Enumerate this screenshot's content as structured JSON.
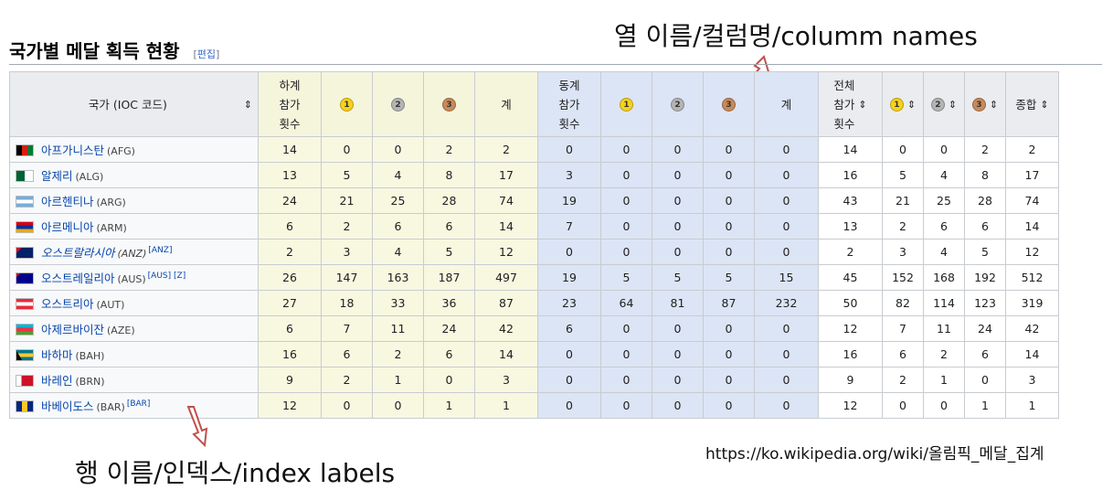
{
  "annotations": {
    "column_names": "열 이름/컬럼명/columm names",
    "index_labels": "행 이름/인덱스/index labels",
    "source_url": "https://ko.wikipedia.org/wiki/올림픽_메달_집계"
  },
  "section": {
    "title": "국가별 메달 획득 현황",
    "edit_open": "[",
    "edit_label": "편집",
    "edit_close": "]"
  },
  "headers": {
    "country": "국가 (IOC 코드)",
    "summer_games": [
      "하계",
      "참가",
      "횟수"
    ],
    "winter_games": [
      "동계",
      "참가",
      "횟수"
    ],
    "total_games": [
      "전체",
      "참가",
      "횟수"
    ],
    "gold": "1",
    "silver": "2",
    "bronze": "3",
    "subtotal": "계",
    "grand_total": "종합"
  },
  "colors": {
    "gold": "#f7d21a",
    "silver": "#b4b4b4",
    "bronze": "#c88a5a",
    "summer_bg": "#f8f8e0",
    "winter_bg": "#dce5f5",
    "link": "#0645ad"
  },
  "rows": [
    {
      "name": "아프가니스탄",
      "ioc": "(AFG)",
      "note": "",
      "italic": false,
      "flag": "afg",
      "summer": [
        "14",
        "0",
        "0",
        "2",
        "2"
      ],
      "winter": [
        "0",
        "0",
        "0",
        "0",
        "0"
      ],
      "total": [
        "14",
        "0",
        "0",
        "2",
        "2"
      ]
    },
    {
      "name": "알제리",
      "ioc": "(ALG)",
      "note": "",
      "italic": false,
      "flag": "alg",
      "summer": [
        "13",
        "5",
        "4",
        "8",
        "17"
      ],
      "winter": [
        "3",
        "0",
        "0",
        "0",
        "0"
      ],
      "total": [
        "16",
        "5",
        "4",
        "8",
        "17"
      ]
    },
    {
      "name": "아르헨티나",
      "ioc": "(ARG)",
      "note": "",
      "italic": false,
      "flag": "arg",
      "summer": [
        "24",
        "21",
        "25",
        "28",
        "74"
      ],
      "winter": [
        "19",
        "0",
        "0",
        "0",
        "0"
      ],
      "total": [
        "43",
        "21",
        "25",
        "28",
        "74"
      ]
    },
    {
      "name": "아르메니아",
      "ioc": "(ARM)",
      "note": "",
      "italic": false,
      "flag": "arm",
      "summer": [
        "6",
        "2",
        "6",
        "6",
        "14"
      ],
      "winter": [
        "7",
        "0",
        "0",
        "0",
        "0"
      ],
      "total": [
        "13",
        "2",
        "6",
        "6",
        "14"
      ]
    },
    {
      "name": "오스트랄라시아",
      "ioc": "(ANZ)",
      "note": "[ANZ]",
      "italic": true,
      "flag": "anz",
      "summer": [
        "2",
        "3",
        "4",
        "5",
        "12"
      ],
      "winter": [
        "0",
        "0",
        "0",
        "0",
        "0"
      ],
      "total": [
        "2",
        "3",
        "4",
        "5",
        "12"
      ]
    },
    {
      "name": "오스트레일리아",
      "ioc": "(AUS)",
      "note": "[AUS] [Z]",
      "italic": false,
      "flag": "aus",
      "summer": [
        "26",
        "147",
        "163",
        "187",
        "497"
      ],
      "winter": [
        "19",
        "5",
        "5",
        "5",
        "15"
      ],
      "total": [
        "45",
        "152",
        "168",
        "192",
        "512"
      ]
    },
    {
      "name": "오스트리아",
      "ioc": "(AUT)",
      "note": "",
      "italic": false,
      "flag": "aut",
      "summer": [
        "27",
        "18",
        "33",
        "36",
        "87"
      ],
      "winter": [
        "23",
        "64",
        "81",
        "87",
        "232"
      ],
      "total": [
        "50",
        "82",
        "114",
        "123",
        "319"
      ]
    },
    {
      "name": "아제르바이잔",
      "ioc": "(AZE)",
      "note": "",
      "italic": false,
      "flag": "aze",
      "summer": [
        "6",
        "7",
        "11",
        "24",
        "42"
      ],
      "winter": [
        "6",
        "0",
        "0",
        "0",
        "0"
      ],
      "total": [
        "12",
        "7",
        "11",
        "24",
        "42"
      ]
    },
    {
      "name": "바하마",
      "ioc": "(BAH)",
      "note": "",
      "italic": false,
      "flag": "bah",
      "summer": [
        "16",
        "6",
        "2",
        "6",
        "14"
      ],
      "winter": [
        "0",
        "0",
        "0",
        "0",
        "0"
      ],
      "total": [
        "16",
        "6",
        "2",
        "6",
        "14"
      ]
    },
    {
      "name": "바레인",
      "ioc": "(BRN)",
      "note": "",
      "italic": false,
      "flag": "brn",
      "summer": [
        "9",
        "2",
        "1",
        "0",
        "3"
      ],
      "winter": [
        "0",
        "0",
        "0",
        "0",
        "0"
      ],
      "total": [
        "9",
        "2",
        "1",
        "0",
        "3"
      ]
    },
    {
      "name": "바베이도스",
      "ioc": "(BAR)",
      "note": "[BAR]",
      "italic": false,
      "flag": "bar",
      "summer": [
        "12",
        "0",
        "0",
        "1",
        "1"
      ],
      "winter": [
        "0",
        "0",
        "0",
        "0",
        "0"
      ],
      "total": [
        "12",
        "0",
        "0",
        "1",
        "1"
      ]
    }
  ]
}
